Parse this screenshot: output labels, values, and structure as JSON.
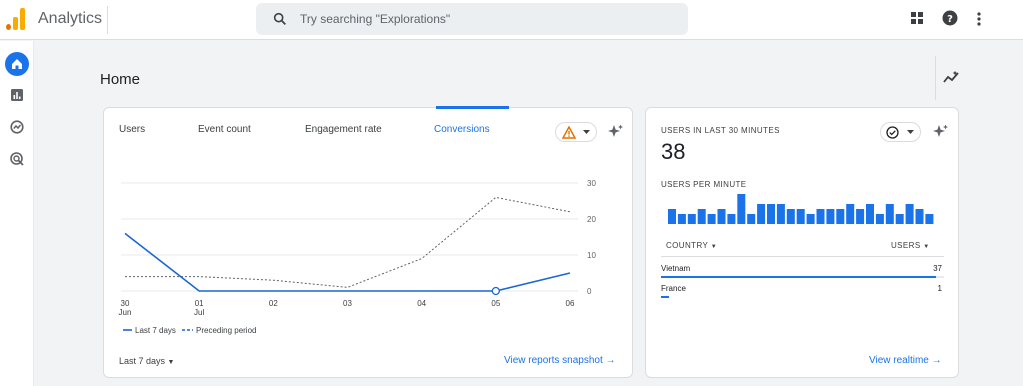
{
  "app": {
    "name": "Analytics"
  },
  "search": {
    "placeholder": "Try searching \"Explorations\""
  },
  "topbar_icons": [
    "apps-grid-icon",
    "help-icon",
    "more-vert-icon"
  ],
  "nav_rail": [
    "home-icon",
    "reports-icon",
    "explore-icon",
    "advertising-icon"
  ],
  "page": {
    "title": "Home"
  },
  "tabs": [
    {
      "label": "Users"
    },
    {
      "label": "Event count"
    },
    {
      "label": "Engagement rate"
    },
    {
      "label": "Conversions",
      "active": true
    }
  ],
  "chart": {
    "date_range": "Last 7 days",
    "view_link": "View reports snapshot",
    "legend": [
      "Last 7 days",
      "Preceding period"
    ],
    "x_labels": [
      {
        "top": "30",
        "bottom": "Jun"
      },
      {
        "top": "01",
        "bottom": "Jul"
      },
      {
        "top": "02",
        "bottom": ""
      },
      {
        "top": "03",
        "bottom": ""
      },
      {
        "top": "04",
        "bottom": ""
      },
      {
        "top": "05",
        "bottom": ""
      },
      {
        "top": "06",
        "bottom": ""
      }
    ]
  },
  "chart_data": {
    "type": "line",
    "x": [
      "30 Jun",
      "01 Jul",
      "02",
      "03",
      "04",
      "05",
      "06"
    ],
    "series": [
      {
        "name": "Last 7 days",
        "values": [
          16,
          0,
          0,
          0,
          0,
          0,
          5
        ],
        "style": "solid",
        "color": "#1967d2"
      },
      {
        "name": "Preceding period",
        "values": [
          4,
          4,
          3,
          1,
          9,
          26,
          22
        ],
        "style": "dotted",
        "color": "#5f6368"
      }
    ],
    "yticks": [
      0,
      10,
      20,
      30
    ],
    "ylim": [
      0,
      30
    ],
    "grid": true,
    "legend_position": "bottom-left"
  },
  "realtime": {
    "heading": "USERS IN LAST 30 MINUTES",
    "count": "38",
    "per_minute_label": "USERS PER MINUTE",
    "per_minute": [
      3,
      2,
      2,
      3,
      2,
      3,
      2,
      6,
      2,
      4,
      4,
      4,
      3,
      3,
      2,
      3,
      3,
      3,
      4,
      3,
      4,
      2,
      4,
      2,
      4,
      3,
      2
    ],
    "bar_color": "#1a73e8",
    "col_country": "COUNTRY",
    "col_users": "USERS",
    "rows": [
      {
        "country": "Vietnam",
        "users": "37",
        "share": 0.97
      },
      {
        "country": "France",
        "users": "1",
        "share": 0.03
      }
    ],
    "view_link": "View realtime"
  },
  "colors": {
    "accent": "#1a73e8",
    "warning": "#e37400",
    "logo": "#f9ab00"
  }
}
